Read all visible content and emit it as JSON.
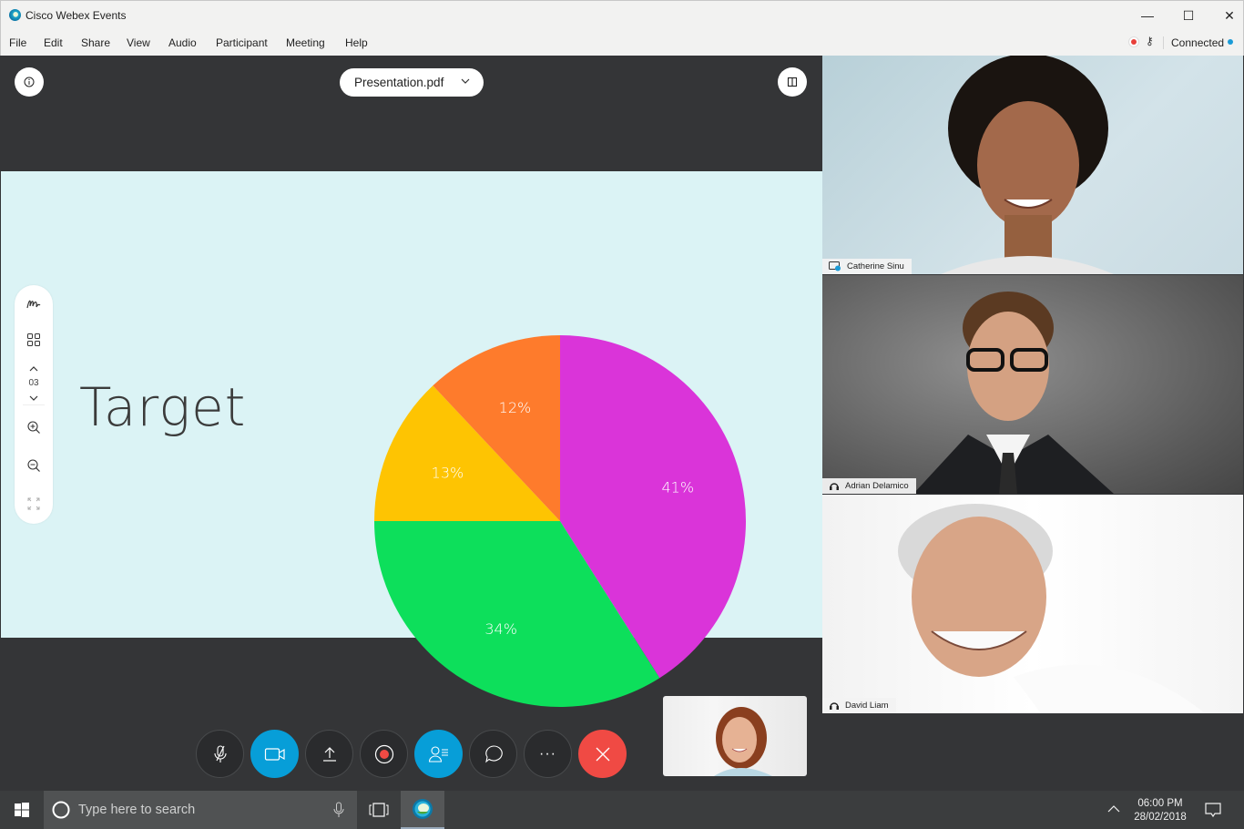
{
  "window": {
    "app_name": "Cisco Webex Events",
    "controls": {
      "minimize": "—",
      "maximize": "☐",
      "close": "✕"
    }
  },
  "menu": [
    "File",
    "Edit",
    "Share",
    "View",
    "Audio",
    "Participant",
    "Meeting",
    "Help"
  ],
  "status": {
    "recording_icon": "record-dot",
    "connection_label": "Connected",
    "connection_color": "#1a9bd7"
  },
  "stage": {
    "file_selector": "Presentation.pdf",
    "toolbox": {
      "page_number": "03"
    },
    "slide_title": "Target",
    "slide_background": "#dbf3f5"
  },
  "chart_data": {
    "type": "pie",
    "title": "Target",
    "start_angle": "12 o'clock, clockwise",
    "slices": [
      {
        "label": "41%",
        "value": 41,
        "color": "#da34d9"
      },
      {
        "label": "34%",
        "value": 34,
        "color": "#0ddf5b"
      },
      {
        "label": "13%",
        "value": 13,
        "color": "#fec402"
      },
      {
        "label": "12%",
        "value": 12,
        "color": "#fe7b2c"
      }
    ]
  },
  "controls": [
    {
      "name": "mute",
      "icon": "microphone-muted-icon",
      "active": false
    },
    {
      "name": "video",
      "icon": "video-camera-icon",
      "active": true
    },
    {
      "name": "share",
      "icon": "upload-icon",
      "active": false
    },
    {
      "name": "record",
      "icon": "record-icon",
      "active": false
    },
    {
      "name": "participants",
      "icon": "participants-icon",
      "active": true
    },
    {
      "name": "chat",
      "icon": "chat-bubble-icon",
      "active": false
    },
    {
      "name": "more",
      "icon": "more-icon",
      "label": "···",
      "active": false
    },
    {
      "name": "leave",
      "icon": "close-icon",
      "active": false
    }
  ],
  "participants": [
    {
      "name": "Catherine Sinu",
      "status_icon": "video-presenter-icon"
    },
    {
      "name": "Adrian Delamico",
      "status_icon": "headset-icon"
    },
    {
      "name": "David Liam",
      "status_icon": "headset-icon"
    }
  ],
  "taskbar": {
    "search_placeholder": "Type here to search",
    "time": "06:00 PM",
    "date": "28/02/2018"
  }
}
